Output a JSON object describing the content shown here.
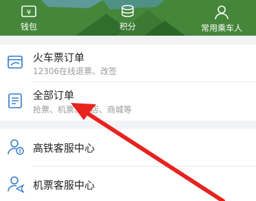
{
  "header": {
    "items": [
      {
        "label": "钱包",
        "icon": "ticket-wallet-icon"
      },
      {
        "label": "积分",
        "icon": "coins-icon"
      },
      {
        "label": "常用乘车人",
        "icon": "person-icon"
      }
    ]
  },
  "orders": [
    {
      "title": "火车票订单",
      "subtitle": "12306在线退票、改签",
      "icon": "train-ticket-icon"
    },
    {
      "title": "全部订单",
      "subtitle": "抢票、机票、酒店、商城等",
      "icon": "list-document-icon"
    }
  ],
  "service": [
    {
      "title": "高铁客服中心",
      "icon": "rail-service-agent-icon"
    },
    {
      "title": "机票客服中心",
      "icon": "flight-service-agent-icon"
    }
  ],
  "colors": {
    "header": "#45863a",
    "icon_blue": "#2a78c8",
    "arrow_red": "#e8231f"
  }
}
